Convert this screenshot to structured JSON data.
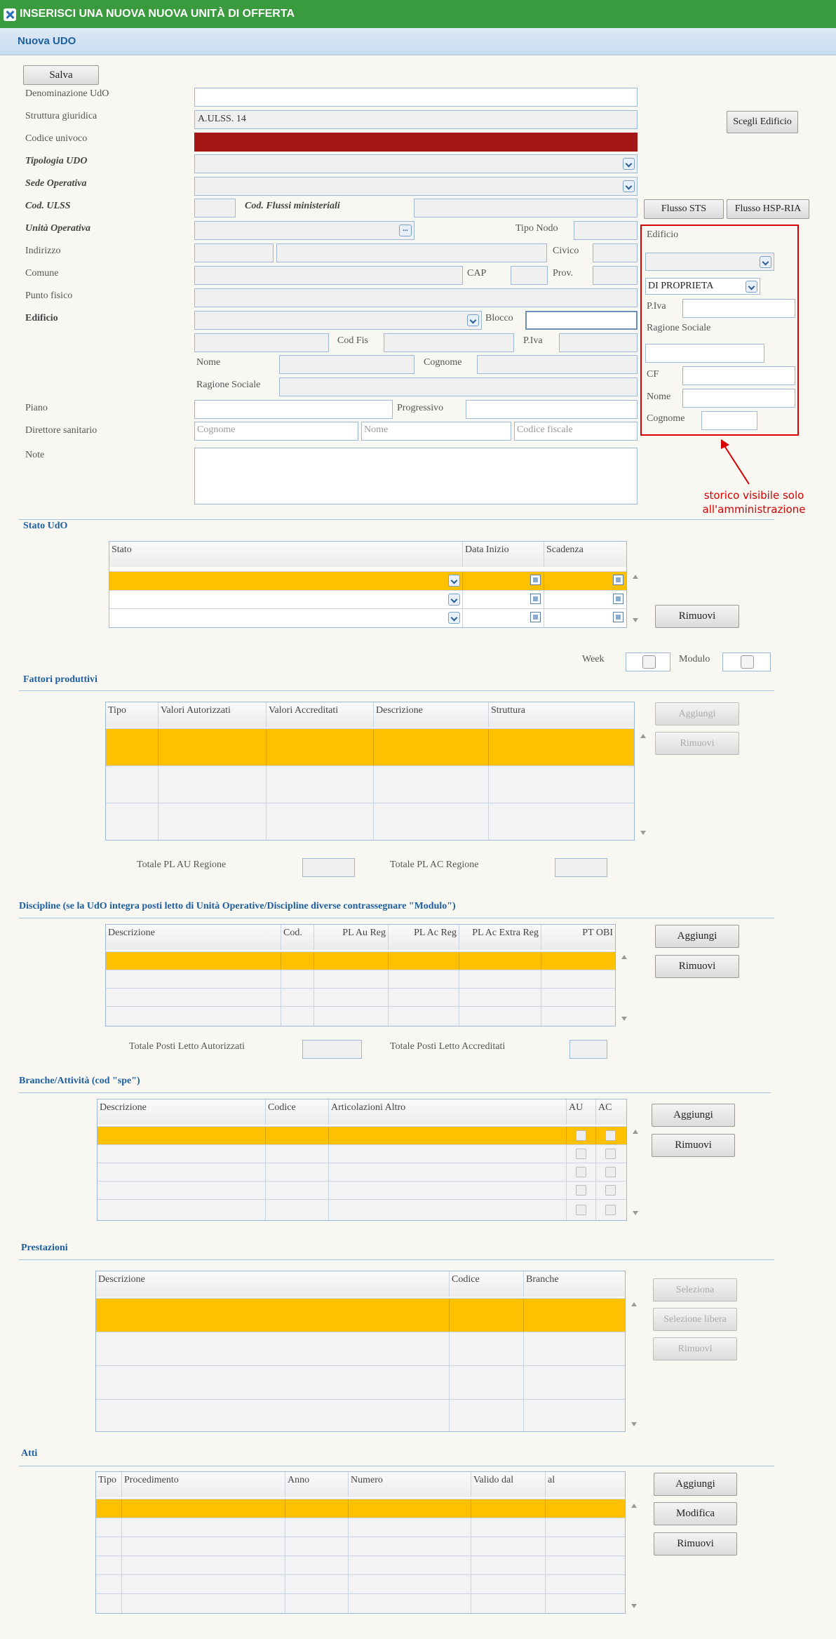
{
  "window": {
    "title": "INSERISCI UNA NUOVA NUOVA UNITÀ DI OFFERTA",
    "subtitle": "Nuova UDO"
  },
  "buttons": {
    "salva": "Salva",
    "scegli_edificio": "Scegli Edificio",
    "flusso_sts": "Flusso STS",
    "flusso_hsp": "Flusso HSP-RIA",
    "rimuovi": "Rimuovi",
    "aggiungi": "Aggiungi",
    "modifica": "Modifica",
    "seleziona": "Seleziona",
    "selezione_libera": "Selezione libera"
  },
  "form": {
    "denominazione": "Denominazione UdO",
    "struttura": "Struttura giuridica",
    "struttura_value": "A.ULSS. 14",
    "codice": "Codice univoco",
    "tipologia": "Tipologia UDO",
    "sede": "Sede Operativa",
    "cod_ulss": "Cod. ULSS",
    "cod_flussi": "Cod. Flussi ministeriali",
    "unita_operativa": "Unità Operativa",
    "ellipsis": "...",
    "tipo_nodo": "Tipo Nodo",
    "indirizzo": "Indirizzo",
    "civico": "Civico",
    "comune": "Comune",
    "cap": "CAP",
    "prov": "Prov.",
    "punto_fisico": "Punto fisico",
    "edificio": "Edificio",
    "blocco": "Blocco",
    "cod_fis": "Cod Fis",
    "piva": "P.Iva",
    "nome": "Nome",
    "cognome": "Cognome",
    "ragione_sociale": "Ragione Sociale",
    "piano": "Piano",
    "progressivo": "Progressivo",
    "direttore": "Direttore sanitario",
    "ph_cognome": "Cognome",
    "ph_nome": "Nome",
    "ph_cf": "Codice fiscale",
    "note": "Note"
  },
  "side_panel": {
    "edificio": "Edificio",
    "proprieta": "DI PROPRIETA",
    "piva": "P.Iva",
    "ragione_sociale": "Ragione Sociale",
    "cf": "CF",
    "nome": "Nome",
    "cognome": "Cognome"
  },
  "annotation": {
    "line1": "storico visibile solo",
    "line2": "all'amministrazione"
  },
  "stato": {
    "title": "Stato UdO",
    "columns": [
      "Stato",
      "Data Inizio",
      "Scadenza"
    ],
    "week": "Week",
    "modulo": "Modulo"
  },
  "fattori": {
    "title": "Fattori produttivi",
    "columns": [
      "Tipo",
      "Valori Autorizzati",
      "Valori Accreditati",
      "Descrizione",
      "Struttura"
    ],
    "tot_au": "Totale PL AU Regione",
    "tot_ac": "Totale PL AC Regione"
  },
  "discipline": {
    "title": "Discipline (se la UdO integra posti letto di Unità Operative/Discipline diverse contrassegnare \"Modulo\")",
    "columns": [
      "Descrizione",
      "Cod.",
      "PL Au Reg",
      "PL Ac Reg",
      "PL Ac Extra Reg",
      "PT OBI"
    ],
    "tot_aut": "Totale Posti Letto Autorizzati",
    "tot_acc": "Totale Posti Letto Accreditati"
  },
  "branche": {
    "title": "Branche/Attività (cod \"spe\")",
    "columns": [
      "Descrizione",
      "Codice",
      "Articolazioni Altro",
      "AU",
      "AC"
    ]
  },
  "prestazioni": {
    "title": "Prestazioni",
    "columns": [
      "Descrizione",
      "Codice",
      "Branche"
    ]
  },
  "atti": {
    "title": "Atti",
    "columns": [
      "Tipo",
      "Procedimento",
      "Anno",
      "Numero",
      "Valido dal",
      "al"
    ]
  },
  "colors": {
    "titlebar": "#3a9a3e",
    "selected_row": "#ffc000",
    "required_field": "#a51616",
    "annotation": "#d60000"
  }
}
